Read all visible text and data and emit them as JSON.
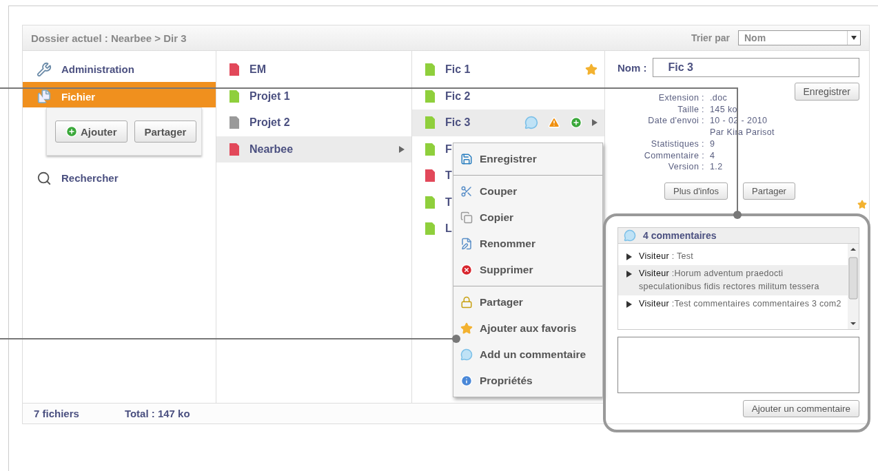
{
  "header": {
    "breadcrumb": "Dossier actuel : Nearbee >  Dir 3",
    "sort_label": "Trier par",
    "sort_value": "Nom"
  },
  "sidebar": {
    "items": [
      {
        "label": "Administration",
        "selected": false
      },
      {
        "label": "Fichier",
        "selected": true,
        "actions": [
          "Ajouter",
          "Partager"
        ]
      },
      {
        "label": "Rechercher",
        "selected": false
      }
    ]
  },
  "folders": [
    {
      "name": "EM",
      "color": "#e2485a",
      "selected": false
    },
    {
      "name": "Projet 1",
      "color": "#8fcf3c",
      "selected": false
    },
    {
      "name": "Projet 2",
      "color": "#9a9a9a",
      "selected": false
    },
    {
      "name": "Nearbee",
      "color": "#e2485a",
      "selected": true
    }
  ],
  "files": [
    {
      "name": "Fic 1",
      "color": "#8fcf3c",
      "selected": false,
      "favorite": true
    },
    {
      "name": "Fic 2",
      "color": "#8fcf3c",
      "selected": false,
      "favorite": false
    },
    {
      "name": "Fic 3",
      "color": "#8fcf3c",
      "selected": true,
      "favorite": false
    },
    {
      "name": "F",
      "color": "#8fcf3c",
      "selected": false,
      "favorite": false
    },
    {
      "name": "T",
      "color": "#e2485a",
      "selected": false,
      "favorite": false
    },
    {
      "name": "T",
      "color": "#8fcf3c",
      "selected": false,
      "favorite": false
    },
    {
      "name": "L",
      "color": "#8fcf3c",
      "selected": false,
      "favorite": false
    }
  ],
  "context_menu": {
    "sections": [
      [
        "Enregistrer"
      ],
      [
        "Couper",
        "Copier",
        "Renommer",
        "Supprimer"
      ],
      [
        "Partager",
        "Ajouter aux favoris",
        "Add un commentaire",
        "Propriétés"
      ]
    ]
  },
  "details": {
    "name_label": "Nom :",
    "name_value": "Fic 3",
    "save_button": "Enregistrer",
    "properties": [
      {
        "label": "Extension :",
        "value": ".doc"
      },
      {
        "label": "Taille :",
        "value": "145 ko"
      },
      {
        "label": "Date d'envoi :",
        "value": "10 - 02 - 2010"
      },
      {
        "value": "Par  Kira Parisot"
      },
      {
        "label": "Statistiques :",
        "value": "9"
      },
      {
        "label": "Commentaire :",
        "value": "4"
      },
      {
        "label": "Version :",
        "value": "1.2"
      }
    ],
    "buttons": [
      "Plus d'infos",
      "Partager"
    ]
  },
  "comments": {
    "title": "4 commentaires",
    "items": [
      {
        "author": "Visiteur",
        "text": " : Test",
        "selected": false
      },
      {
        "author": "Visiteur",
        "text": " :Horum adventum praedocti speculationibus fidis rectores militum tessera",
        "selected": true
      },
      {
        "author": "Visiteur",
        "text": " :Test commentaires commentaires 3 com2",
        "selected": false
      }
    ],
    "submit": "Ajouter un commentaire"
  },
  "footer": {
    "count": "7 fichiers",
    "total": "Total : 147 ko"
  }
}
